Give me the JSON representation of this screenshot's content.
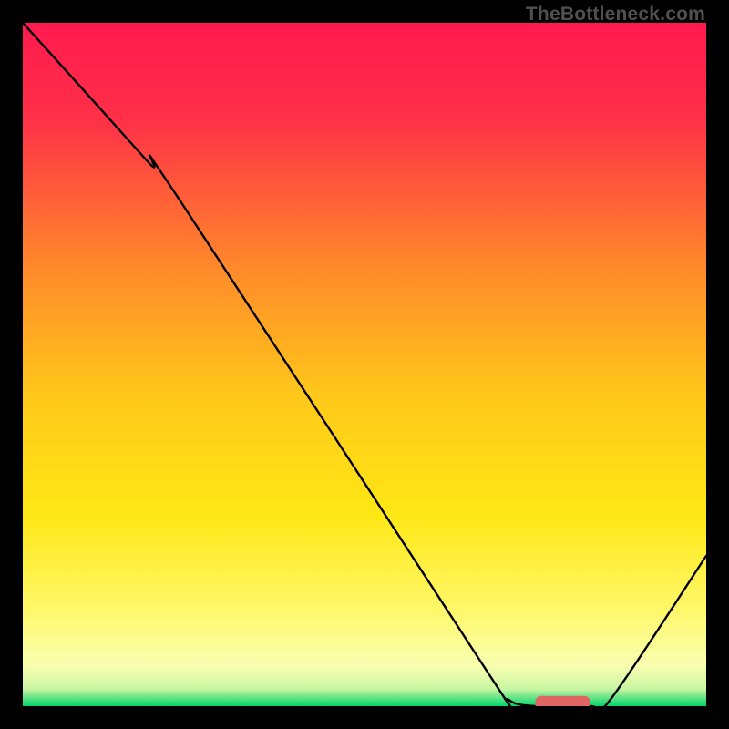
{
  "watermark": "TheBottleneck.com",
  "chart_data": {
    "type": "line",
    "title": "",
    "xlabel": "",
    "ylabel": "",
    "xlim": [
      0,
      100
    ],
    "ylim": [
      0,
      100
    ],
    "grid": false,
    "legend": false,
    "gradient_stops": [
      {
        "offset": 0,
        "color": "#ff1a4e"
      },
      {
        "offset": 0.14,
        "color": "#ff3048"
      },
      {
        "offset": 0.36,
        "color": "#ff8a2a"
      },
      {
        "offset": 0.55,
        "color": "#ffc91a"
      },
      {
        "offset": 0.72,
        "color": "#ffe715"
      },
      {
        "offset": 0.86,
        "color": "#fff86a"
      },
      {
        "offset": 0.94,
        "color": "#f9ffb0"
      },
      {
        "offset": 0.975,
        "color": "#c8f5a2"
      },
      {
        "offset": 1.0,
        "color": "#00d56a"
      }
    ],
    "series": [
      {
        "name": "bottleneck-curve",
        "color": "#000000",
        "width": 2.4,
        "points": [
          {
            "x": 0,
            "y": 100
          },
          {
            "x": 18,
            "y": 80
          },
          {
            "x": 23,
            "y": 74
          },
          {
            "x": 68,
            "y": 5
          },
          {
            "x": 71,
            "y": 1
          },
          {
            "x": 75,
            "y": 0
          },
          {
            "x": 83,
            "y": 0
          },
          {
            "x": 86,
            "y": 1
          },
          {
            "x": 100,
            "y": 22
          }
        ]
      }
    ],
    "marker": {
      "name": "optimal-segment",
      "color": "#e06666",
      "x_start": 75,
      "x_end": 83,
      "y": 0,
      "thickness": 2.2
    }
  }
}
